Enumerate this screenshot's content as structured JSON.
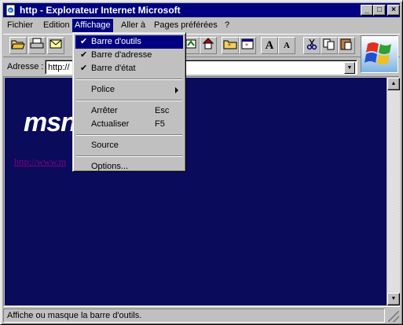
{
  "window": {
    "title": "http - Explorateur Internet Microsoft"
  },
  "titlebar": {
    "minimize": "_",
    "maximize": "□",
    "close": "×"
  },
  "menubar": {
    "items": [
      {
        "label": "Fichier"
      },
      {
        "label": "Edition"
      },
      {
        "label": "Affichage"
      },
      {
        "label": "Aller à"
      },
      {
        "label": "Pages préférées"
      },
      {
        "label": "?"
      }
    ]
  },
  "toolbar": {
    "buttons": [
      "open-icon",
      "print-icon",
      "mail-icon",
      "refresh-icon",
      "home-icon",
      "favorites-icon",
      "new-window-icon",
      "font-larger-icon",
      "font-smaller-icon",
      "cut-icon",
      "copy-icon",
      "paste-icon"
    ],
    "font_larger": "A",
    "font_smaller": "A"
  },
  "address": {
    "label": "Adresse :",
    "value": "http://"
  },
  "page": {
    "brand": "msn",
    "link": "http://www.m"
  },
  "status": {
    "text": "Affiche ou masque la barre d'outils."
  },
  "dropdown": {
    "items": [
      {
        "label": "Barre d'outils",
        "checked": true
      },
      {
        "label": "Barre d'adresse",
        "checked": true
      },
      {
        "label": "Barre d'état",
        "checked": true
      },
      {
        "label": "Police",
        "submenu": true
      },
      {
        "label": "Arrêter",
        "shortcut": "Esc"
      },
      {
        "label": "Actualiser",
        "shortcut": "F5"
      },
      {
        "label": "Source"
      },
      {
        "label": "Options..."
      }
    ],
    "check": "✔"
  },
  "colors": {
    "titlebar": "#000080",
    "page_background": "#0b0b5c",
    "highlight": "#000080",
    "visited_link": "#800080"
  }
}
